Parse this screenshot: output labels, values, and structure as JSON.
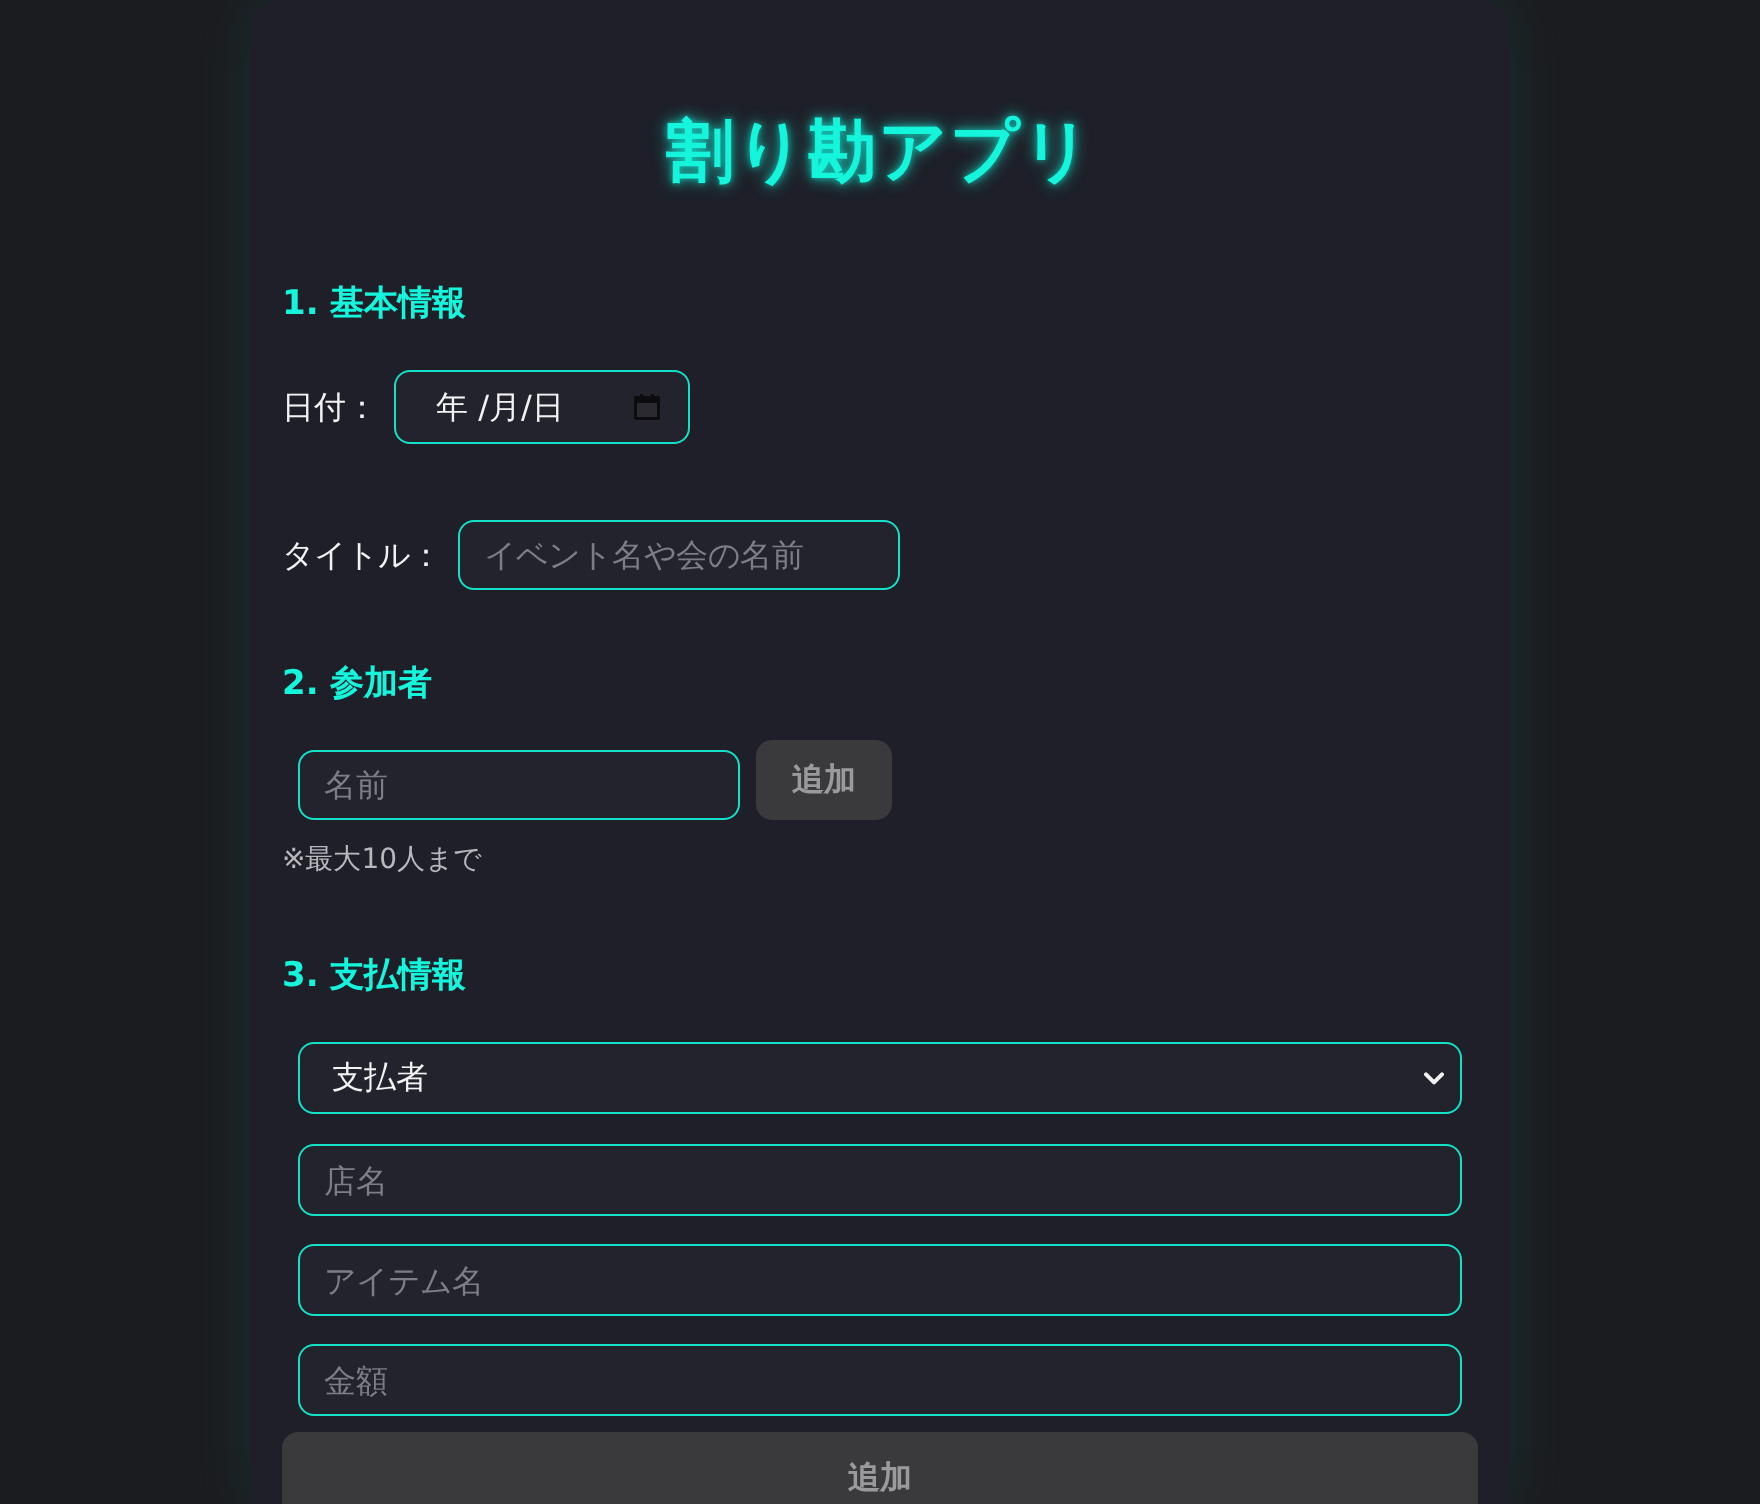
{
  "app": {
    "title": "割り勘アプリ"
  },
  "basic_info": {
    "heading": "1. 基本情報",
    "date": {
      "label": "日付：",
      "display": "年 /月/日"
    },
    "title_field": {
      "label": "タイトル：",
      "placeholder": "イベント名や会の名前"
    }
  },
  "participants": {
    "heading": "2. 参加者",
    "name_field": {
      "placeholder": "名前"
    },
    "add_button": "追加",
    "note": "※最大10人まで"
  },
  "payment": {
    "heading": "3. 支払情報",
    "payer_select": {
      "value": "支払者"
    },
    "fields": [
      {
        "placeholder": "店名"
      },
      {
        "placeholder": "アイテム名"
      },
      {
        "placeholder": "金額"
      }
    ],
    "add_button": "追加"
  }
}
